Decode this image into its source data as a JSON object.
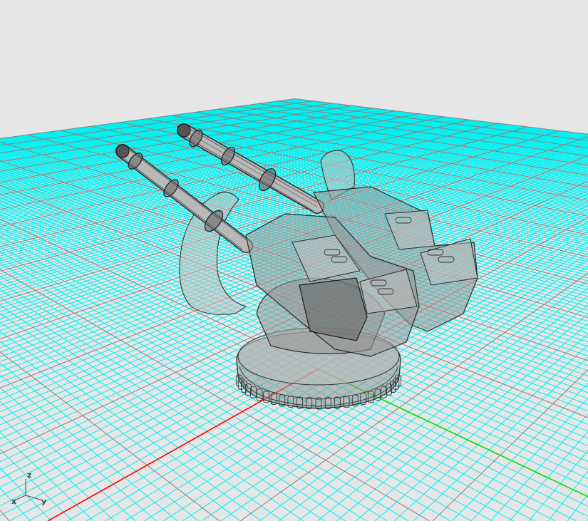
{
  "viewport": {
    "background_color": "#e6e6e6",
    "minor_grid_color": "#00f0f0",
    "major_grid_color": "#8c7f7f",
    "x_axis_color": "#ff0000",
    "y_axis_color": "#00e000",
    "model": "gatling-turret"
  },
  "axis_indicator": {
    "x_label": "x",
    "y_label": "y",
    "z_label": "z"
  }
}
